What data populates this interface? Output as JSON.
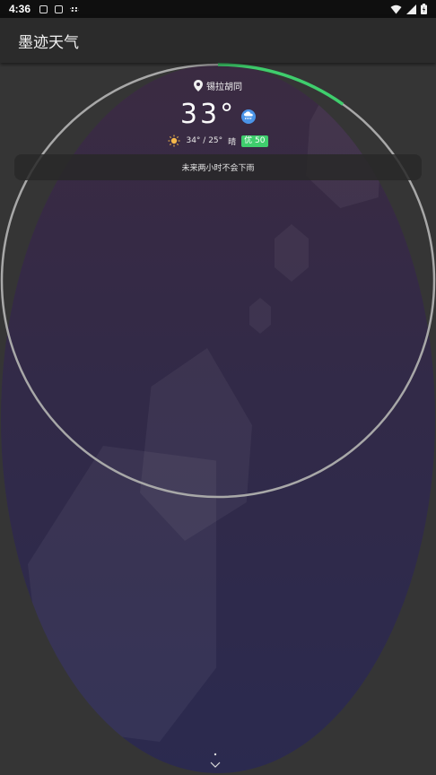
{
  "status_bar": {
    "time": "4:36",
    "notifications": [
      "watch-icon",
      "a-icon",
      "wavy-icon"
    ],
    "indicators": [
      "wifi-icon",
      "signal-icon",
      "battery-icon"
    ]
  },
  "app": {
    "title": "墨迹天气"
  },
  "weather": {
    "location": "锡拉胡同",
    "temperature": "33°",
    "condition_icon": "rain-icon",
    "high_low": "34° / 25°",
    "condition": "晴",
    "aqi": "优 50",
    "forecast": "未来两小时不会下雨"
  },
  "colors": {
    "accent_green": "#3fce6d",
    "rain_blue": "#4b95e8"
  }
}
